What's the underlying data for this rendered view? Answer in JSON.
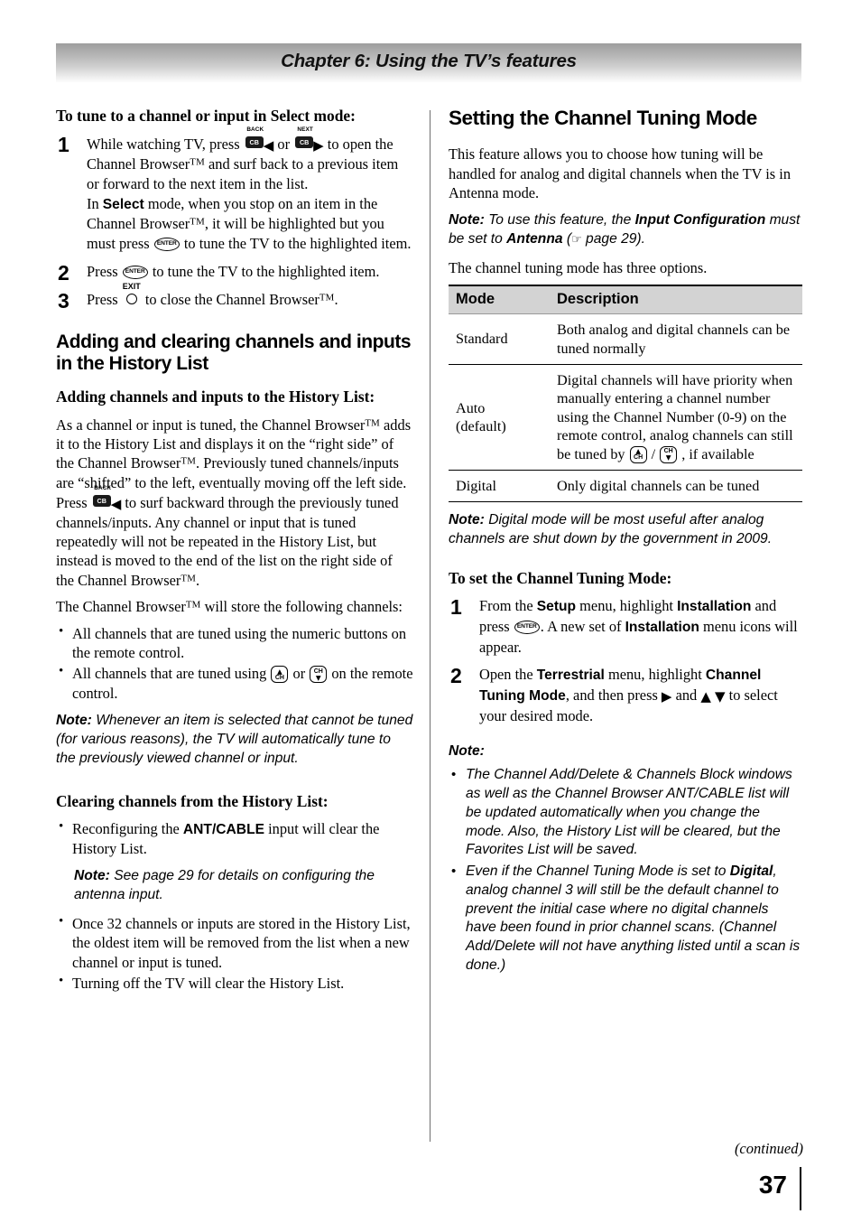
{
  "header": {
    "chapter_title": "Chapter 6: Using the TV’s features"
  },
  "footer": {
    "continued": "(continued)",
    "page_number": "37"
  },
  "icons": {
    "cb_key_label": "CB",
    "back_caption": "BACK",
    "next_caption": "NEXT",
    "enter_key_label": "ENTER",
    "exit_caption": "EXIT",
    "ch_label": "CH",
    "arrow_left": "◀",
    "arrow_right": "▶",
    "arrow_up": "▲",
    "arrow_down": "▼",
    "hand_pointer": "☞"
  },
  "left_column": {
    "heading_select_mode": "To tune to a channel or input in Select mode:",
    "steps": [
      {
        "num": "1",
        "parts": {
          "t1": "While watching TV, press ",
          "t2": " or ",
          "t3": " to open the Channel Browser",
          "t4": " and surf back to a previous item or forward to the next item in the list.",
          "t5": "In ",
          "b1": "Select",
          "t6": " mode, when you stop on an item in the Channel Browser",
          "t7": ", it will be highlighted but you must press ",
          "t8": " to tune the TV to the highlighted item."
        }
      },
      {
        "num": "2",
        "parts": {
          "t1": "Press ",
          "t2": " to tune the TV to the highlighted item."
        }
      },
      {
        "num": "3",
        "parts": {
          "t1": "Press ",
          "t2": " to close the Channel Browser",
          "t3": "."
        }
      }
    ],
    "heading_adding_clearing": "Adding and clearing channels and inputs in the History List",
    "heading_adding": "Adding channels and inputs to the History List:",
    "para_adding_1": "As a channel or input is tuned, the Channel Browser",
    "para_adding_1b": " adds it to the History List and displays it on the “right side” of the Channel Browser",
    "para_adding_1c": ". Previously tuned channels/inputs are “shifted” to the left, eventually moving off the left side. Press ",
    "para_adding_1d": " to surf backward through the previously tuned channels/inputs. Any channel or input that is tuned repeatedly will not be repeated in the History List, but instead is moved to the end of the list on the right side of the Channel Browser",
    "para_adding_1e": ".",
    "para_store_a": "The Channel Browser",
    "para_store_b": " will store the following channels:",
    "bullets_store": [
      "All channels that are tuned using the numeric buttons on the remote control."
    ],
    "bullet_ch_a": "All channels that are tuned using ",
    "bullet_ch_b": " or ",
    "bullet_ch_c": " on the remote control.",
    "note_cannot_tune_label": "Note:",
    "note_cannot_tune_text": " Whenever an item is selected that cannot be tuned (for various reasons), the TV will automatically tune to the previously viewed channel or input.",
    "heading_clearing": "Clearing channels from the History List:",
    "bullet_reconfig_a": "Reconfiguring the ",
    "bullet_reconfig_b": "ANT/CABLE",
    "bullet_reconfig_c": " input will clear the History List.",
    "note_page29_label": "Note:",
    "note_page29_text": " See page 29 for details on configuring the antenna input.",
    "bullets_tail": [
      "Once 32 channels or inputs are stored in the History List, the oldest item will be removed from the list when a new channel or input is tuned.",
      "Turning off the TV will clear the History List."
    ]
  },
  "right_column": {
    "heading_main": "Setting the Channel Tuning Mode",
    "intro_para": "This feature allows you to choose how tuning will be handled for analog and digital channels when the TV is in Antenna mode.",
    "note_input_config": {
      "label": "Note:",
      "t1": " To use this feature, the ",
      "b1": "Input Configuration",
      "t2": " must be set to ",
      "b2": "Antenna",
      "t3": " (",
      "t4": " page 29)."
    },
    "three_options_line": "The channel tuning mode has three options.",
    "table": {
      "headers": [
        "Mode",
        "Description"
      ],
      "rows": [
        {
          "mode": "Standard",
          "description": "Both analog and digital channels can be tuned normally",
          "has_icons": false
        },
        {
          "mode": "Auto (default)",
          "mode_line1": "Auto",
          "mode_line2": "(default)",
          "desc_a": "Digital channels will have priority when manually entering a channel number using the Channel Number (0-9) on the remote control, analog channels can still be tuned by ",
          "desc_b": " / ",
          "desc_c": " , if available",
          "has_icons": true
        },
        {
          "mode": "Digital",
          "description": "Only digital channels can be tuned",
          "has_icons": false
        }
      ]
    },
    "note_2009": {
      "label": "Note:",
      "text": " Digital mode will be most useful after analog channels are shut down by the government in 2009."
    },
    "heading_to_set": "To set the Channel Tuning Mode:",
    "steps": [
      {
        "num": "1",
        "t1": "From the ",
        "b1": "Setup",
        "t2": " menu, highlight ",
        "b2": "Installation",
        "t3": " and press ",
        "t4": ". A new set of ",
        "b3": "Installation",
        "t5": " menu icons will appear."
      },
      {
        "num": "2",
        "t1": "Open the ",
        "b1": "Terrestrial",
        "t2": " menu, highlight ",
        "b2": "Channel Tuning Mode",
        "t3": ", and then press ",
        "t4": " and ",
        "t5": " to select your desired mode."
      }
    ],
    "note_bullets_label": "Note:",
    "note_bullet_1": "The Channel Add/Delete & Channels Block windows as well as the Channel Browser ANT/CABLE list will be updated automatically when you change the mode. Also, the History List will be cleared, but the Favorites List will be saved.",
    "note_bullet_2": {
      "t1": "Even if the Channel Tuning Mode is set to ",
      "b1": "Digital",
      "t2": ", analog channel 3 will still be the default channel to prevent the initial case where no digital channels have been found in prior channel scans. (Channel Add/Delete will not have anything listed until a scan is done.)"
    }
  },
  "colors": {
    "header_gradient_top": "#9e9e9e",
    "header_gradient_bottom": "#ffffff",
    "table_header_bg": "#d3d3d3",
    "rule": "#000000",
    "divider": "#6f6f6f"
  }
}
